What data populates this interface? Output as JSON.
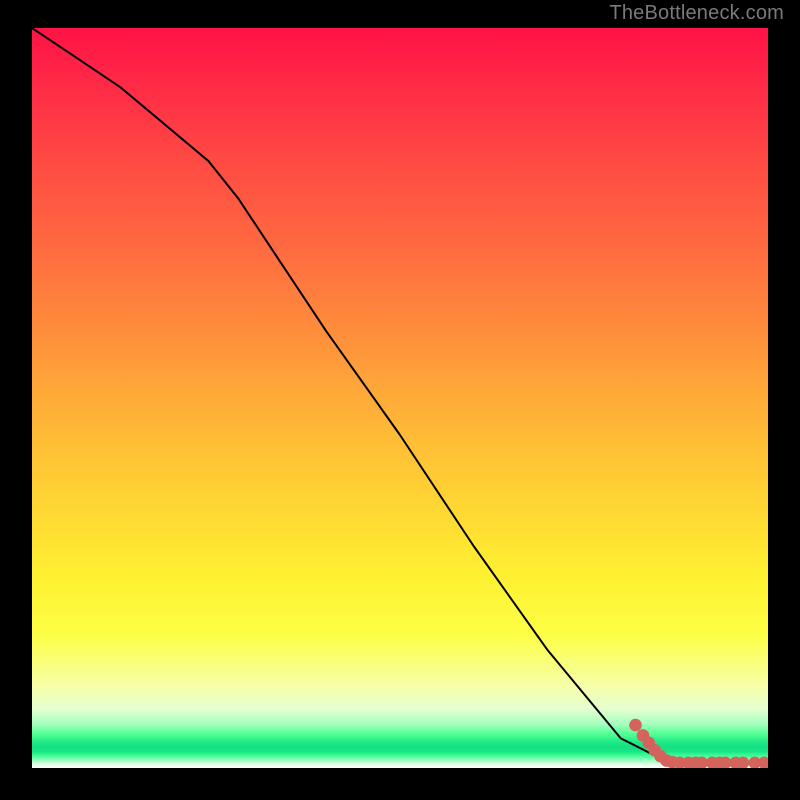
{
  "attribution": "TheBottleneck.com",
  "chart_data": {
    "type": "line",
    "title": "",
    "xlabel": "",
    "ylabel": "",
    "xlim": [
      0,
      100
    ],
    "ylim": [
      0,
      100
    ],
    "series": [
      {
        "name": "curve",
        "x": [
          0,
          6,
          12,
          18,
          24,
          28,
          30,
          34,
          40,
          50,
          60,
          70,
          80,
          86,
          88
        ],
        "y": [
          100,
          96,
          92,
          87,
          82,
          77,
          74,
          68,
          59,
          45,
          30,
          16,
          4,
          1,
          0.7
        ]
      }
    ],
    "markers": {
      "name": "dots",
      "color": "#d4635e",
      "radius_pct": 0.85,
      "points": [
        {
          "x": 82.0,
          "y": 5.8
        },
        {
          "x": 83.0,
          "y": 4.4
        },
        {
          "x": 83.8,
          "y": 3.4
        },
        {
          "x": 84.6,
          "y": 2.4
        },
        {
          "x": 85.4,
          "y": 1.6
        },
        {
          "x": 86.2,
          "y": 1.0
        },
        {
          "x": 87.0,
          "y": 0.8
        },
        {
          "x": 88.0,
          "y": 0.7
        },
        {
          "x": 89.2,
          "y": 0.7
        },
        {
          "x": 90.2,
          "y": 0.7
        },
        {
          "x": 91.0,
          "y": 0.7
        },
        {
          "x": 92.4,
          "y": 0.7
        },
        {
          "x": 93.4,
          "y": 0.7
        },
        {
          "x": 94.2,
          "y": 0.7
        },
        {
          "x": 95.6,
          "y": 0.7
        },
        {
          "x": 96.6,
          "y": 0.7
        },
        {
          "x": 98.2,
          "y": 0.7
        },
        {
          "x": 99.5,
          "y": 0.7
        }
      ]
    }
  }
}
